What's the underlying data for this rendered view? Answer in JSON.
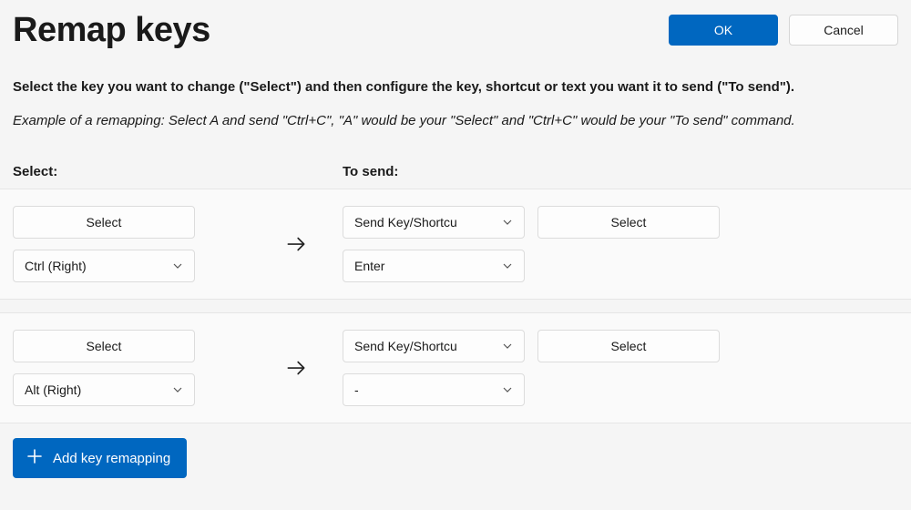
{
  "header": {
    "title": "Remap keys",
    "ok_label": "OK",
    "cancel_label": "Cancel"
  },
  "instructions": {
    "main": "Select the key you want to change (\"Select\") and then configure the key, shortcut or text you want it to send (\"To send\").",
    "example": "Example of a remapping: Select A and send \"Ctrl+C\", \"A\" would be your \"Select\" and \"Ctrl+C\" would be your \"To send\" command."
  },
  "columns": {
    "select": "Select:",
    "to_send": "To send:"
  },
  "rows": [
    {
      "select_button": "Select",
      "select_dropdown": "Ctrl (Right)",
      "send_type_dropdown": "Send Key/Shortcu",
      "send_select_button": "Select",
      "send_key_dropdown": "Enter"
    },
    {
      "select_button": "Select",
      "select_dropdown": "Alt (Right)",
      "send_type_dropdown": "Send Key/Shortcu",
      "send_select_button": "Select",
      "send_key_dropdown": "-"
    }
  ],
  "footer": {
    "add_label": "Add key remapping"
  }
}
